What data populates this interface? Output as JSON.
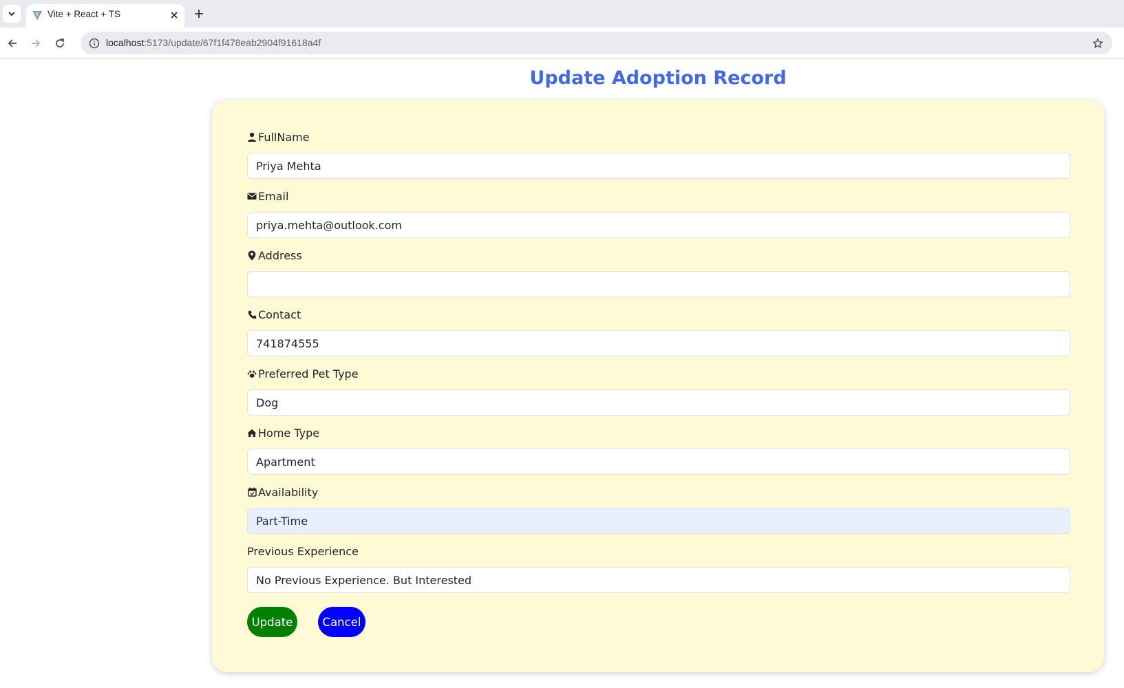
{
  "browser": {
    "tab_title": "Vite + React + TS",
    "url_host": "localhost",
    "url_path": ":5173/update/67f1f478eab2904f91618a4f"
  },
  "page": {
    "title": "Update Adoption Record"
  },
  "form": {
    "fields": [
      {
        "label": "FullName",
        "icon": "person-icon",
        "value": "Priya Mehta"
      },
      {
        "label": "Email",
        "icon": "envelope-icon",
        "value": "priya.mehta@outlook.com"
      },
      {
        "label": "Address",
        "icon": "location-pin-icon",
        "value": ""
      },
      {
        "label": "Contact",
        "icon": "phone-icon",
        "value": "741874555"
      },
      {
        "label": "Preferred Pet Type",
        "icon": "paw-icon",
        "value": "Dog"
      },
      {
        "label": "Home Type",
        "icon": "house-icon",
        "value": "Apartment"
      },
      {
        "label": "Availability",
        "icon": "calendar-icon",
        "value": "Part-Time"
      },
      {
        "label": "Previous Experience",
        "icon": "",
        "value": "No Previous Experience. But Interested"
      }
    ],
    "update_label": "Update",
    "cancel_label": "Cancel"
  },
  "colors": {
    "title": "#4169e1",
    "card_background": "#fffad6",
    "update_button": "#008000",
    "cancel_button": "#0000ff",
    "autofill_background": "#e8f0fe"
  }
}
